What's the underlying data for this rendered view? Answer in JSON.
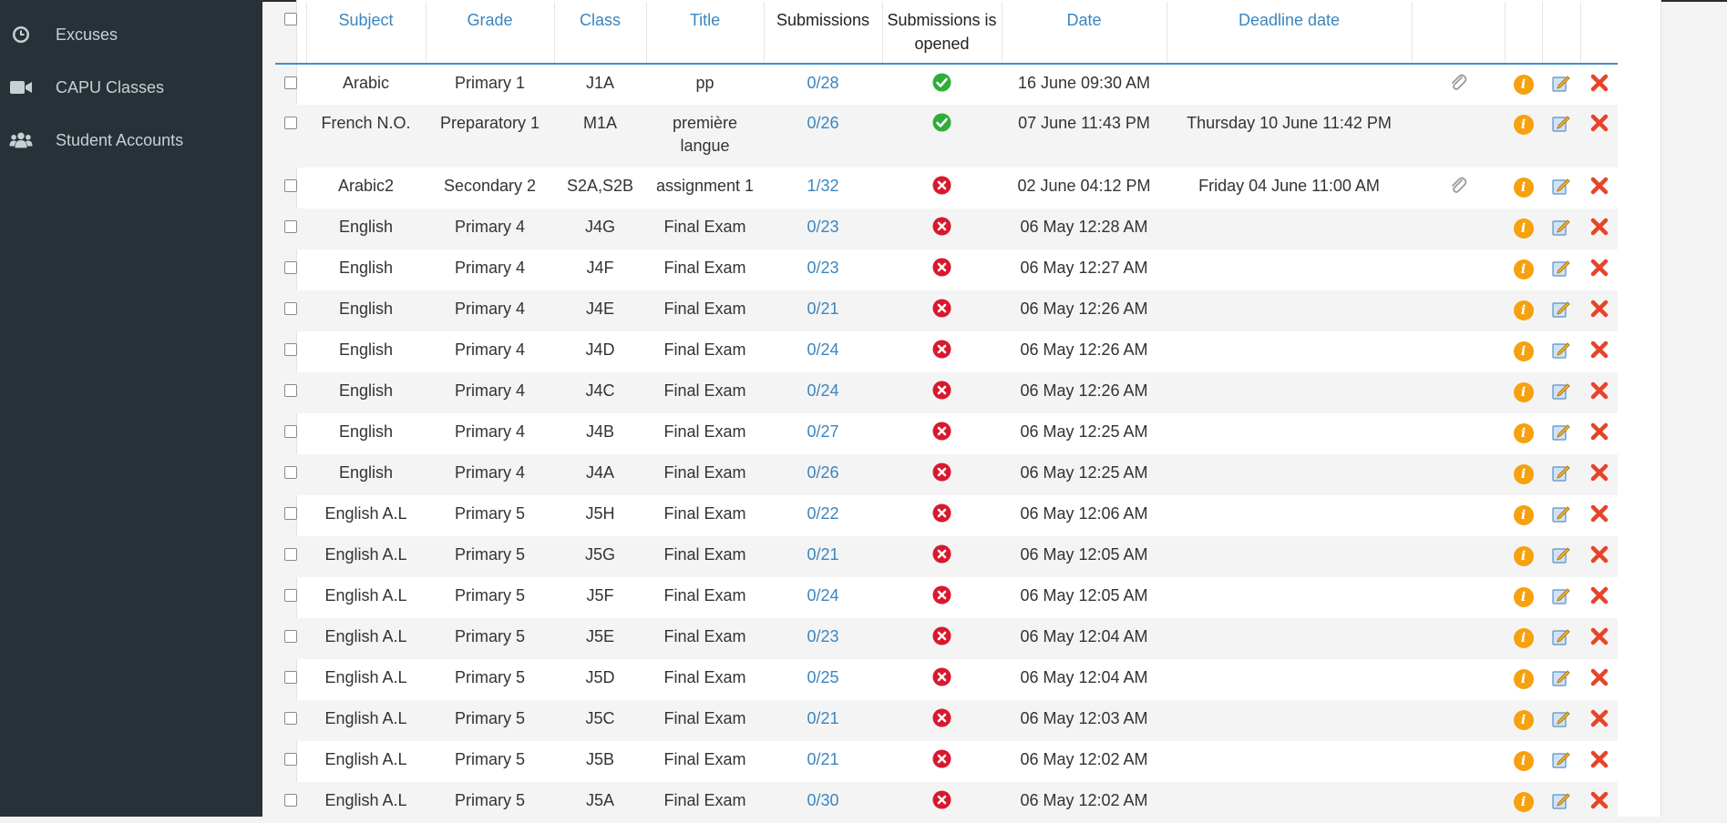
{
  "sidebar": {
    "items": [
      {
        "label": "Excuses",
        "icon": "clock-icon"
      },
      {
        "label": "CAPU Classes",
        "icon": "video-camera-icon"
      },
      {
        "label": "Student Accounts",
        "icon": "users-icon"
      }
    ]
  },
  "table": {
    "headers": {
      "subject": "Subject",
      "grade": "Grade",
      "class": "Class",
      "title": "Title",
      "submissions": "Submissions",
      "submissions_opened": "Submissions is opened",
      "date": "Date",
      "deadline": "Deadline date"
    },
    "rows": [
      {
        "subject": "Arabic",
        "grade": "Primary 1",
        "class": "J1A",
        "title": "pp",
        "submissions": "0/28",
        "opened": true,
        "date": "16 June 09:30 AM",
        "deadline": "",
        "attachment": true
      },
      {
        "subject": "French N.O.",
        "grade": "Preparatory 1",
        "class": "M1A",
        "title": "première langue",
        "submissions": "0/26",
        "opened": true,
        "date": "07 June 11:43 PM",
        "deadline": "Thursday 10 June 11:42 PM",
        "attachment": false
      },
      {
        "subject": "Arabic2",
        "grade": "Secondary 2",
        "class": "S2A,S2B",
        "title": "assignment 1",
        "submissions": "1/32",
        "opened": false,
        "date": "02 June 04:12 PM",
        "deadline": "Friday 04 June 11:00 AM",
        "attachment": true
      },
      {
        "subject": "English",
        "grade": "Primary 4",
        "class": "J4G",
        "title": "Final Exam",
        "submissions": "0/23",
        "opened": false,
        "date": "06 May 12:28 AM",
        "deadline": "",
        "attachment": false
      },
      {
        "subject": "English",
        "grade": "Primary 4",
        "class": "J4F",
        "title": "Final Exam",
        "submissions": "0/23",
        "opened": false,
        "date": "06 May 12:27 AM",
        "deadline": "",
        "attachment": false
      },
      {
        "subject": "English",
        "grade": "Primary 4",
        "class": "J4E",
        "title": "Final Exam",
        "submissions": "0/21",
        "opened": false,
        "date": "06 May 12:26 AM",
        "deadline": "",
        "attachment": false
      },
      {
        "subject": "English",
        "grade": "Primary 4",
        "class": "J4D",
        "title": "Final Exam",
        "submissions": "0/24",
        "opened": false,
        "date": "06 May 12:26 AM",
        "deadline": "",
        "attachment": false
      },
      {
        "subject": "English",
        "grade": "Primary 4",
        "class": "J4C",
        "title": "Final Exam",
        "submissions": "0/24",
        "opened": false,
        "date": "06 May 12:26 AM",
        "deadline": "",
        "attachment": false
      },
      {
        "subject": "English",
        "grade": "Primary 4",
        "class": "J4B",
        "title": "Final Exam",
        "submissions": "0/27",
        "opened": false,
        "date": "06 May 12:25 AM",
        "deadline": "",
        "attachment": false
      },
      {
        "subject": "English",
        "grade": "Primary 4",
        "class": "J4A",
        "title": "Final Exam",
        "submissions": "0/26",
        "opened": false,
        "date": "06 May 12:25 AM",
        "deadline": "",
        "attachment": false
      },
      {
        "subject": "English A.L",
        "grade": "Primary 5",
        "class": "J5H",
        "title": "Final Exam",
        "submissions": "0/22",
        "opened": false,
        "date": "06 May 12:06 AM",
        "deadline": "",
        "attachment": false
      },
      {
        "subject": "English A.L",
        "grade": "Primary 5",
        "class": "J5G",
        "title": "Final Exam",
        "submissions": "0/21",
        "opened": false,
        "date": "06 May 12:05 AM",
        "deadline": "",
        "attachment": false
      },
      {
        "subject": "English A.L",
        "grade": "Primary 5",
        "class": "J5F",
        "title": "Final Exam",
        "submissions": "0/24",
        "opened": false,
        "date": "06 May 12:05 AM",
        "deadline": "",
        "attachment": false
      },
      {
        "subject": "English A.L",
        "grade": "Primary 5",
        "class": "J5E",
        "title": "Final Exam",
        "submissions": "0/23",
        "opened": false,
        "date": "06 May 12:04 AM",
        "deadline": "",
        "attachment": false
      },
      {
        "subject": "English A.L",
        "grade": "Primary 5",
        "class": "J5D",
        "title": "Final Exam",
        "submissions": "0/25",
        "opened": false,
        "date": "06 May 12:04 AM",
        "deadline": "",
        "attachment": false
      },
      {
        "subject": "English A.L",
        "grade": "Primary 5",
        "class": "J5C",
        "title": "Final Exam",
        "submissions": "0/21",
        "opened": false,
        "date": "06 May 12:03 AM",
        "deadline": "",
        "attachment": false
      },
      {
        "subject": "English A.L",
        "grade": "Primary 5",
        "class": "J5B",
        "title": "Final Exam",
        "submissions": "0/21",
        "opened": false,
        "date": "06 May 12:02 AM",
        "deadline": "",
        "attachment": false
      },
      {
        "subject": "English A.L",
        "grade": "Primary 5",
        "class": "J5A",
        "title": "Final Exam",
        "submissions": "0/30",
        "opened": false,
        "date": "06 May 12:02 AM",
        "deadline": "",
        "attachment": false
      }
    ]
  },
  "colors": {
    "sidebar_bg": "#263238",
    "link": "#3a86c0",
    "opened": "#2fae3a",
    "closed": "#d8192d",
    "info": "#f6a10d",
    "delete": "#e8432a"
  }
}
